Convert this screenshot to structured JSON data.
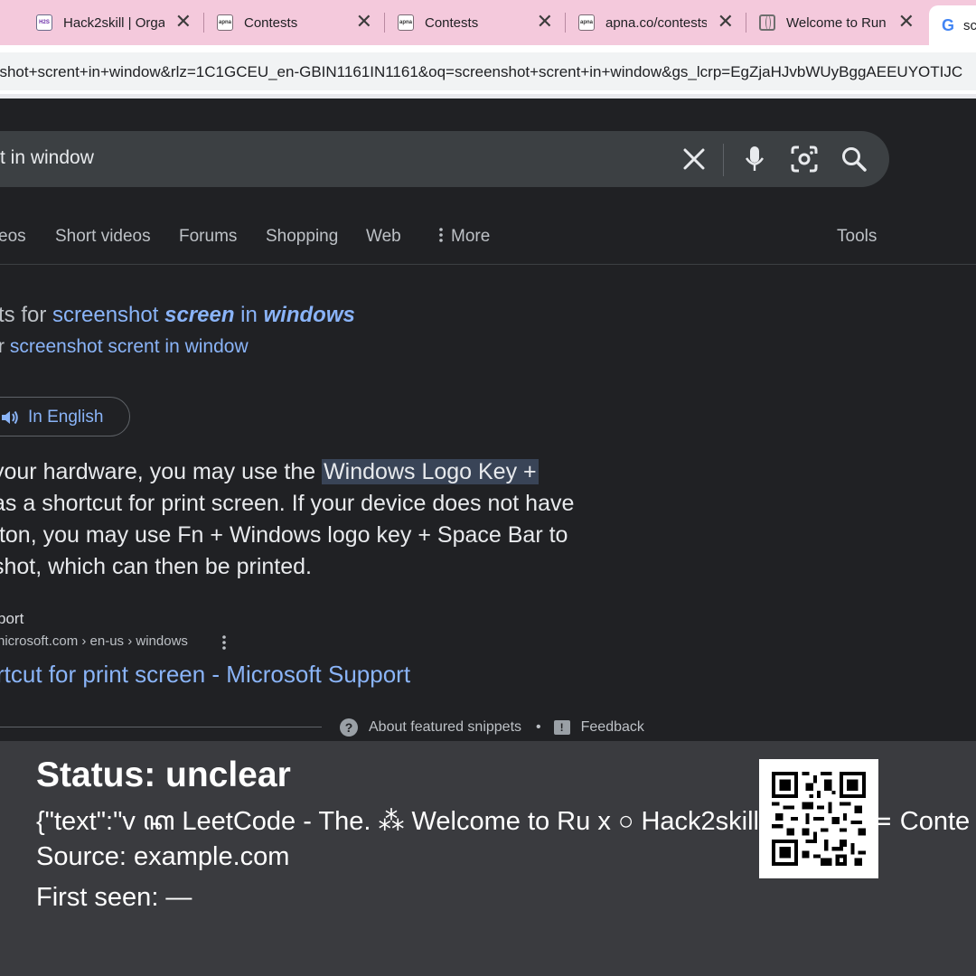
{
  "browser": {
    "tabs": [
      {
        "title": "Hack2skill | Orga",
        "favicon": "hack2skill-favicon"
      },
      {
        "title": "Contests",
        "favicon": "apna-favicon"
      },
      {
        "title": "Contests",
        "favicon": "apna-favicon"
      },
      {
        "title": "apna.co/contests",
        "favicon": "apna-favicon"
      },
      {
        "title": "Welcome to Run",
        "favicon": "globe-favicon"
      },
      {
        "title": "sc",
        "favicon": "google-favicon"
      }
    ],
    "close_glyph": "✕",
    "favicon_text": {
      "apna": "apna",
      "h2s": "H2S",
      "google": "G"
    },
    "url": "nshot+scrent+in+window&rlz=1C1GCEU_en-GBIN1161IN1161&oq=screenshot+scrent+in+window&gs_lcrp=EgZjaHJvbWUyBggAEEUYOTIJC"
  },
  "search": {
    "query": "t in window",
    "tabs": [
      "eos",
      "Short videos",
      "Forums",
      "Shopping",
      "Web",
      "More"
    ],
    "tools_label": "Tools"
  },
  "correction": {
    "line1_prefix": "ts for ",
    "line1_link1": "screenshot ",
    "line1_link2": "screen",
    "line1_link3": " in ",
    "line1_link4": "windows",
    "line2_prefix": "r ",
    "line2_link": "screenshot scrent in window"
  },
  "language_chip": {
    "label": "In English"
  },
  "snippet": {
    "line1_pre": " your hardware, you may use the ",
    "line1_highlight": "Windows Logo Key +",
    "line2": " as a shortcut for print screen. If your device does not have",
    "line3": "tton, you may use Fn + Windows logo key + Space Bar to",
    "line4": "shot, which can then be printed."
  },
  "result": {
    "source_name": "port",
    "source_url": "nicrosoft.com › en-us › windows",
    "title": "rtcut for print screen - Microsoft Support",
    "about_label": "About featured snippets",
    "separator": "•",
    "feedback_label": "Feedback"
  },
  "overlay": {
    "status": "Status: unclear",
    "text": "{\"text\":\"v ꦏ LeetCode - The. ⁂ Welcome to Ru x ○ Hack2skill | Orga x ≔ Conte",
    "source": "Source: example.com",
    "first_seen": "First seen: —"
  },
  "colors": {
    "tab_strip": "#f4c9dc",
    "page_bg": "#202124",
    "link": "#8ab4f8",
    "highlight": "#394457",
    "overlay_bg": "#3a3b3f"
  }
}
